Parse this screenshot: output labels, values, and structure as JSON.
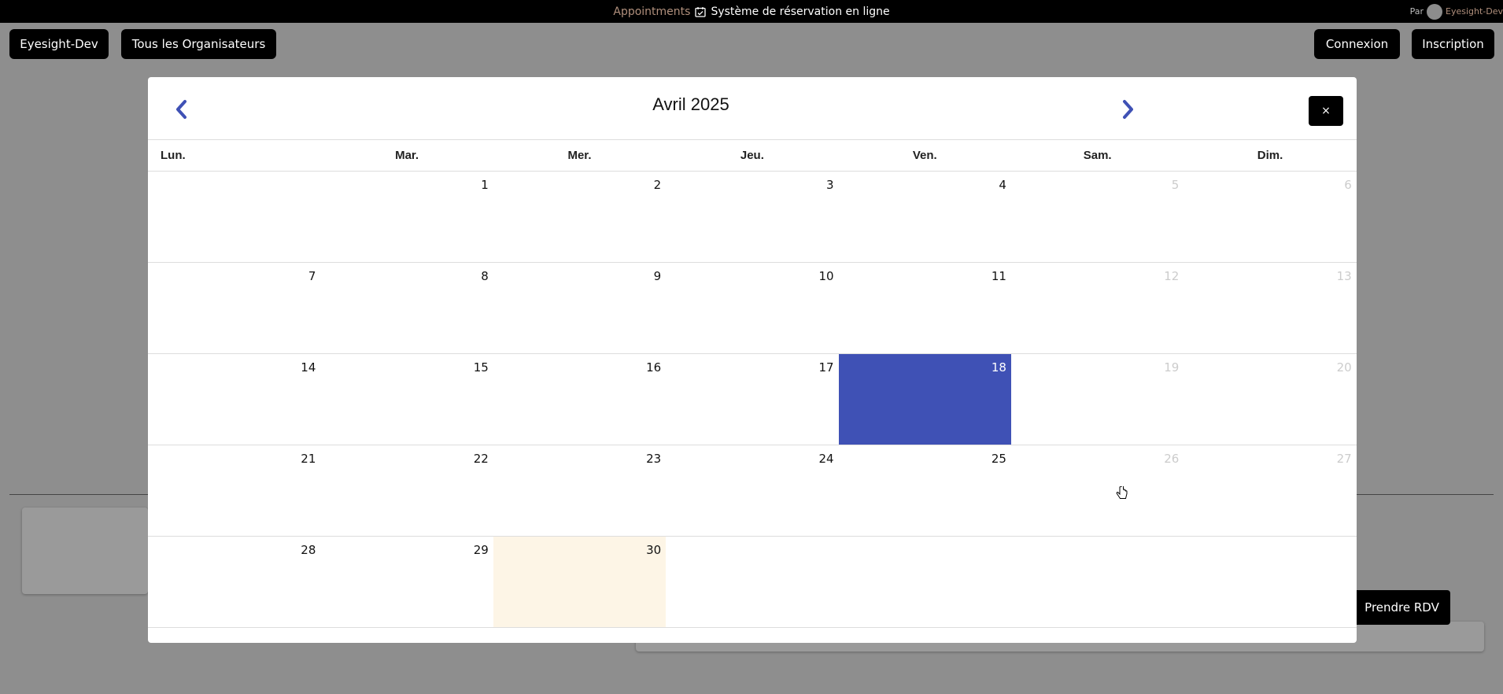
{
  "topbar": {
    "app_name": "Appointments",
    "calendar_icon": "calendar-check-icon",
    "subtitle": "Système de réservation en ligne",
    "by_label": "Par",
    "owner": "Eyesight-Dev"
  },
  "nav": {
    "org_button": "Eyesight-Dev",
    "all_orgs_button": "Tous les Organisateurs",
    "login_button": "Connexion",
    "signup_button": "Inscription"
  },
  "background": {
    "book_button": "Prendre RDV"
  },
  "calendar": {
    "month_title": "Avril 2025",
    "prev_icon": "chevron-left-icon",
    "next_icon": "chevron-right-icon",
    "close_label": "×",
    "weekdays": [
      "Lun.",
      "Mar.",
      "Mer.",
      "Jeu.",
      "Ven.",
      "Sam.",
      "Dim."
    ],
    "weeks": [
      [
        "",
        "1",
        "2",
        "3",
        "4",
        "5",
        "6"
      ],
      [
        "7",
        "8",
        "9",
        "10",
        "11",
        "12",
        "13"
      ],
      [
        "14",
        "15",
        "16",
        "17",
        "18",
        "19",
        "20"
      ],
      [
        "21",
        "22",
        "23",
        "24",
        "25",
        "26",
        "27"
      ],
      [
        "28",
        "29",
        "30",
        "",
        "",
        "",
        ""
      ]
    ],
    "selected_day": "18",
    "today_day": "30",
    "colors": {
      "selected": "#3f51b5",
      "today": "#fdf5e6",
      "nav_arrow": "#3f51b5"
    }
  }
}
